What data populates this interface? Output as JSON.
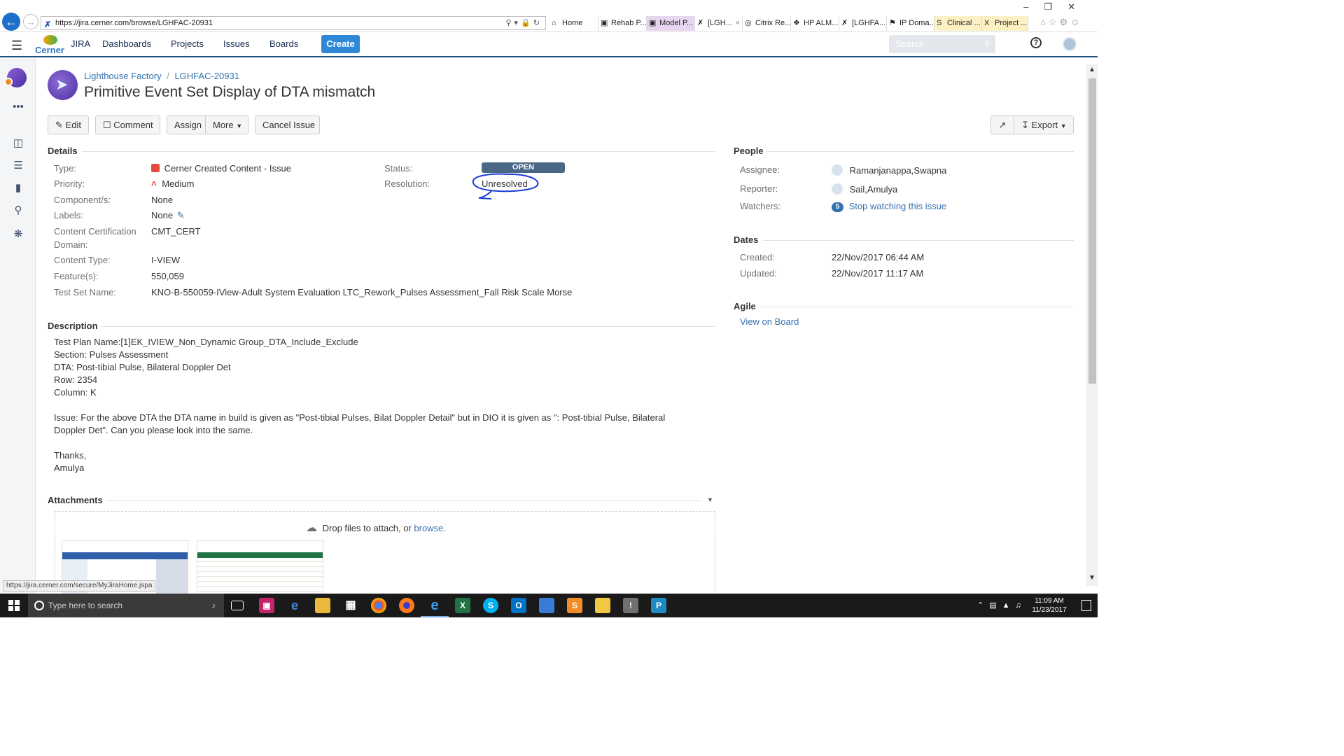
{
  "browser": {
    "url": "https://jira.cerner.com/browse/LGHFAC-20931",
    "tabs": [
      {
        "label": "Home",
        "icon": "home-tab-icon"
      },
      {
        "label": "Rehab P...",
        "icon": "rehab-tab-icon"
      },
      {
        "label": "Model P...",
        "icon": "model-tab-icon"
      },
      {
        "label": "[LGH...",
        "icon": "jira-tab-icon",
        "close": "×"
      },
      {
        "label": "Citrix Re...",
        "icon": "citrix-tab-icon"
      },
      {
        "label": "HP ALM...",
        "icon": "hp-tab-icon"
      },
      {
        "label": "[LGHFA...",
        "icon": "jira-tab-icon"
      },
      {
        "label": "IP Doma...",
        "icon": "ip-tab-icon"
      },
      {
        "label": "Clinical ...",
        "icon": "sharepoint-tab-icon"
      },
      {
        "label": "Project ...",
        "icon": "excel-tab-icon"
      }
    ],
    "status_url": "https://jira.cerner.com/secure/MyJiraHome.jspa"
  },
  "header": {
    "brand": "Cerner",
    "nav": [
      "JIRA",
      "Dashboards",
      "Projects",
      "Issues",
      "Boards"
    ],
    "create_label": "Create",
    "search_placeholder": "Search",
    "help_symbol": "?"
  },
  "issue": {
    "project": "Lighthouse Factory",
    "separator": "/",
    "key": "LGHFAC-20931",
    "title": "Primitive Event Set Display of DTA mismatch"
  },
  "toolbar": {
    "edit": "Edit",
    "comment": "Comment",
    "assign": "Assign",
    "more": "More",
    "cancel_issue": "Cancel Issue",
    "export": "Export"
  },
  "details": {
    "heading": "Details",
    "type_label": "Type:",
    "type_value": "Cerner Created Content - Issue",
    "priority_label": "Priority:",
    "priority_value": "Medium",
    "components_label": "Component/s:",
    "components_value": "None",
    "labels_label": "Labels:",
    "labels_value": "None",
    "cert_label_1": "Content Certification",
    "cert_label_2": "Domain:",
    "cert_value": "CMT_CERT",
    "content_type_label": "Content Type:",
    "content_type_value": "I-VIEW",
    "features_label": "Feature(s):",
    "features_value": "550,059",
    "test_set_label": "Test Set Name:",
    "test_set_value": "KNO-B-550059-IView-Adult System Evaluation LTC_Rework_Pulses Assessment_Fall Risk Scale Morse",
    "status_label": "Status:",
    "status_value": "OPEN",
    "resolution_label": "Resolution:",
    "resolution_value": "Unresolved"
  },
  "people": {
    "heading": "People",
    "assignee_label": "Assignee:",
    "assignee_value": "Ramanjanappa,Swapna",
    "reporter_label": "Reporter:",
    "reporter_value": "Sail,Amulya",
    "watchers_label": "Watchers:",
    "watchers_count": "5",
    "watchers_action": "Stop watching this issue"
  },
  "dates": {
    "heading": "Dates",
    "created_label": "Created:",
    "created_value": "22/Nov/2017 06:44 AM",
    "updated_label": "Updated:",
    "updated_value": "22/Nov/2017 11:17 AM"
  },
  "agile": {
    "heading": "Agile",
    "link": "View on Board"
  },
  "description": {
    "heading": "Description",
    "lines": [
      "Test Plan Name:[1]EK_IVIEW_Non_Dynamic Group_DTA_Include_Exclude",
      "Section: Pulses Assessment",
      "DTA: Post-tibial Pulse, Bilateral Doppler Det",
      "Row: 2354",
      "Column: K",
      "",
      "Issue: For the above DTA the DTA name in build is given as \"Post-tibial Pulses, Bilat Doppler Detail\" but in DIO it is given as \": Post-tibial Pulse, Bilateral Doppler Det\". Can you please look into the same.",
      "",
      "Thanks,",
      "Amulya"
    ]
  },
  "attachments": {
    "heading": "Attachments",
    "drop_text": "Drop files to attach, or",
    "browse": "browse."
  },
  "taskbar": {
    "search_placeholder": "Type here to search",
    "time": "11:09 AM",
    "date": "11/23/2017"
  },
  "colors": {
    "jira_blue": "#205081",
    "link": "#3572b0",
    "create_button": "#2f87d8",
    "status_open": "#4a6785",
    "annotation": "#1a3cd6"
  }
}
